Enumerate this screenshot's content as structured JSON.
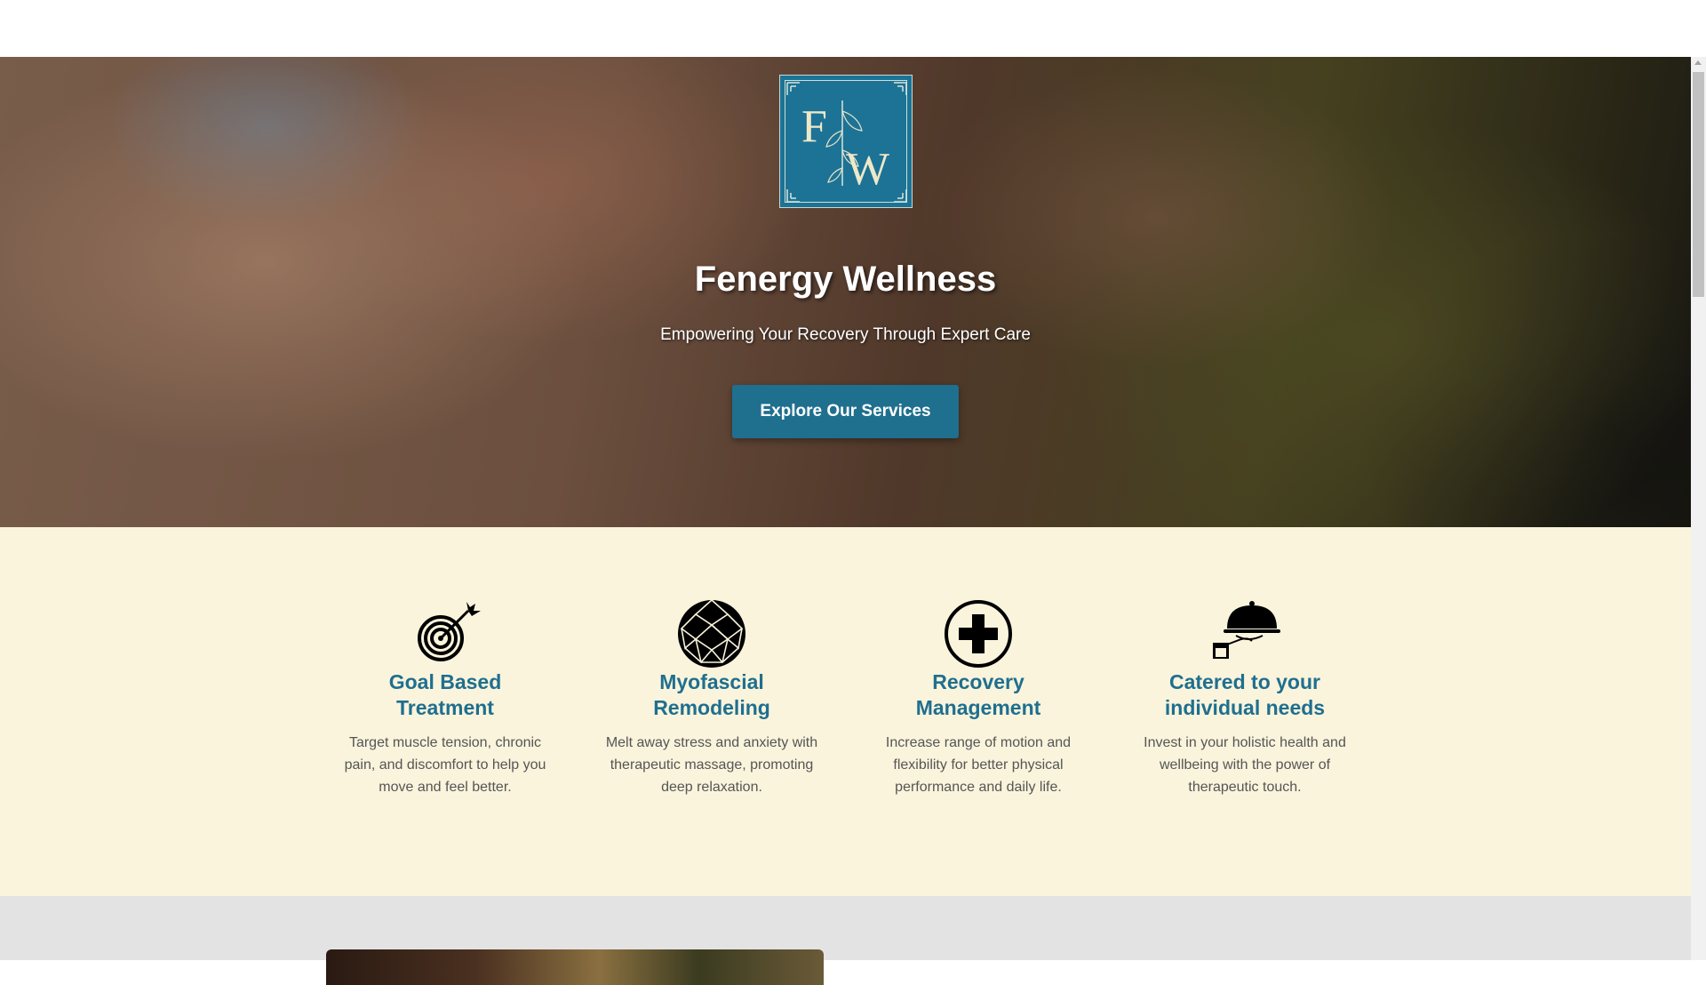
{
  "hero": {
    "logo_letters": [
      "F",
      "W"
    ],
    "title": "Fenergy Wellness",
    "subtitle": "Empowering Your Recovery Through Expert Care",
    "button_label": "Explore Our Services"
  },
  "features": [
    {
      "icon": "target-arrow-icon",
      "title": "Goal Based Treatment",
      "text": "Target muscle tension, chronic pain, and discomfort to help you move and feel better."
    },
    {
      "icon": "geodesic-sphere-icon",
      "title": "Myofascial Remodeling",
      "text": "Melt away stress and anxiety with therapeutic massage, promoting deep relaxation."
    },
    {
      "icon": "medical-cross-icon",
      "title": "Recovery Management",
      "text": "Increase range of motion and flexibility for better physical performance and daily life."
    },
    {
      "icon": "serving-cloche-icon",
      "title": "Catered to your individual needs",
      "text": "Invest in your holistic health and wellbeing with the power of therapeutic touch."
    }
  ],
  "colors": {
    "brand": "#1f6f8f",
    "features_bg": "#faf4dc",
    "gray_section_bg": "#e3e3e3"
  }
}
